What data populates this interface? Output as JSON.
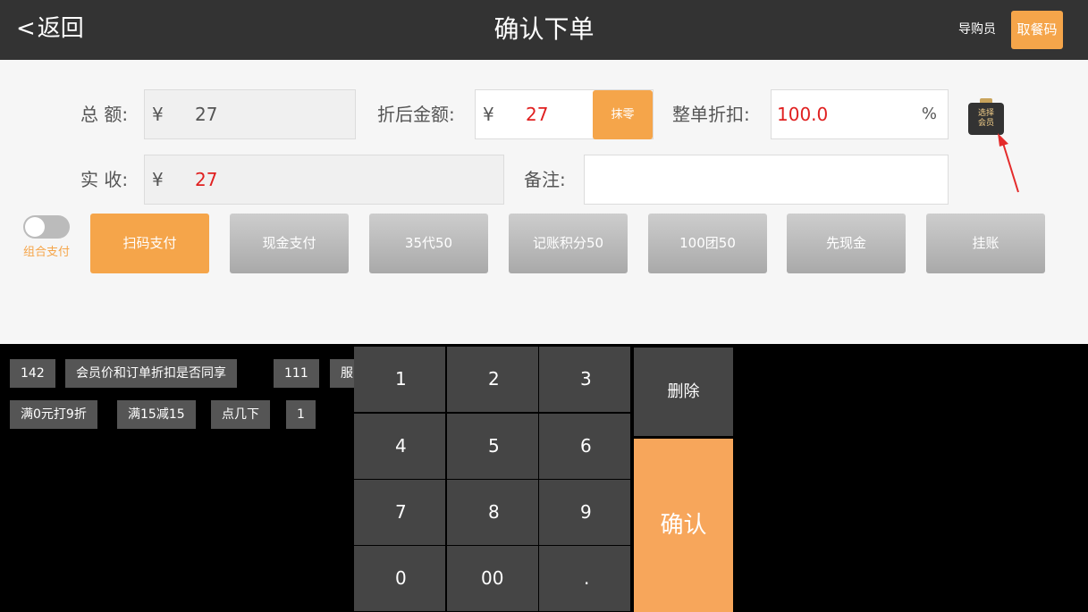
{
  "header": {
    "back_chevron": "<",
    "back_label": "返回",
    "title": "确认下单",
    "guide_label": "导购员",
    "pickup_label": "取餐码"
  },
  "form": {
    "total_label": "总 额:",
    "total_currency": "¥",
    "total_value": "27",
    "discounted_label": "折后金额:",
    "discounted_currency": "¥",
    "discounted_value": "27",
    "round_button": "抹零",
    "order_discount_label": "整单折扣:",
    "order_discount_value": "100.0",
    "percent_sign": "%",
    "received_label": "实 收:",
    "received_currency": "¥",
    "received_value": "27",
    "remark_label": "备注:",
    "remark_value": ""
  },
  "member": {
    "line1": "选择",
    "line2": "会员"
  },
  "combo_pay": {
    "label": "组合支付",
    "enabled": false
  },
  "payment_methods": [
    {
      "label": "扫码支付",
      "active": true
    },
    {
      "label": "现金支付",
      "active": false
    },
    {
      "label": "35代50",
      "active": false
    },
    {
      "label": "记账积分50",
      "active": false
    },
    {
      "label": "100团50",
      "active": false
    },
    {
      "label": "先现金",
      "active": false
    },
    {
      "label": "挂账",
      "active": false
    }
  ],
  "tags": [
    "142",
    "会员价和订单折扣是否同享",
    "111",
    "服",
    "满0元打9折",
    "满15减15",
    "点几下",
    "1"
  ],
  "keypad": {
    "keys": [
      "1",
      "2",
      "3",
      "4",
      "5",
      "6",
      "7",
      "8",
      "9",
      "0",
      "00",
      "."
    ],
    "delete_label": "删除",
    "confirm_label": "确认"
  },
  "colors": {
    "accent": "#f5a54a",
    "header_bg": "#333333",
    "value_red": "#e02020"
  }
}
